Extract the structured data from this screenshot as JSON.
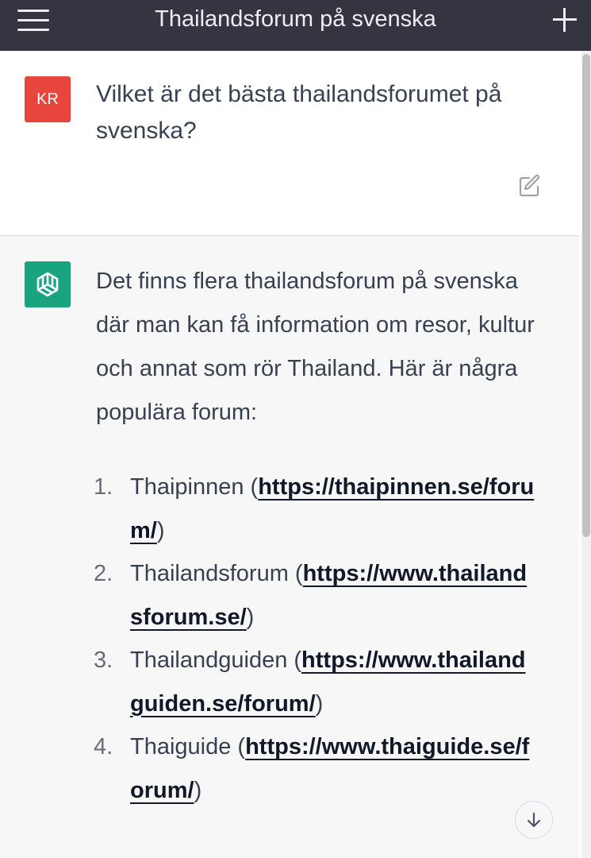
{
  "header": {
    "title": "Thailandsforum på svenska",
    "menu_icon": "hamburger-menu-icon",
    "new_chat_icon": "plus-icon"
  },
  "user_message": {
    "avatar_initials": "KR",
    "avatar_color": "#e8463c",
    "text": "Vilket är det bästa thailandsforumet på svenska?",
    "edit_icon": "edit-icon"
  },
  "assistant_message": {
    "avatar_icon": "openai-logo-icon",
    "avatar_color": "#19a37f",
    "intro": "Det finns flera thailandsforum på svenska där man kan få information om resor, kultur och annat som rör Thailand. Här är några populära forum:",
    "items": [
      {
        "number": "1.",
        "name": "Thaipinnen",
        "url": "https://thaipinnen.se/forum/"
      },
      {
        "number": "2.",
        "name": "Thailandsforum",
        "url": "https://www.thailandsforum.se/"
      },
      {
        "number": "3.",
        "name": "Thailandguiden",
        "url": "https://www.thailandguiden.se/forum/"
      },
      {
        "number": "4.",
        "name": "Thaiguide",
        "url": "https://www.thaiguide.se/forum/"
      }
    ]
  },
  "scroll_button_icon": "arrow-down-icon"
}
